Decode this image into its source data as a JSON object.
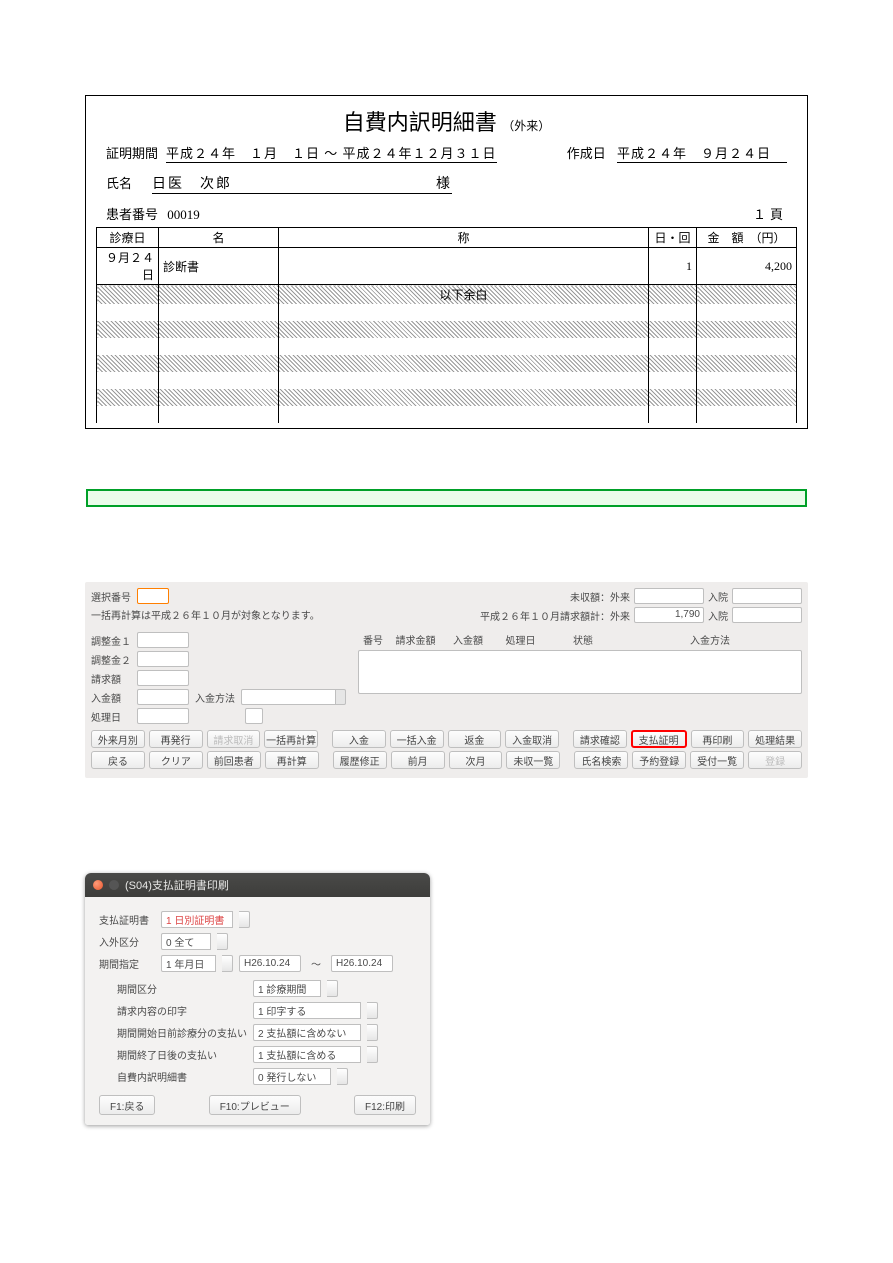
{
  "report": {
    "title_main": "自費内訳明細書",
    "title_sub": "（外来）",
    "period_label": "証明期間",
    "period_value": "平成２４年　１月　１日 ～ 平成２４年１２月３１日",
    "created_label": "作成日",
    "created_value": "平成２４年　９月２４日",
    "name_label": "氏名",
    "name_value": "日医　次郎",
    "name_suffix": "様",
    "patient_id_label": "患者番号",
    "patient_id_value": "00019",
    "page_label": "１頁",
    "columns": {
      "date": "診療日",
      "name": "名",
      "desc": "称",
      "count": "日・回",
      "amount": "金　額　（円）"
    },
    "rows": [
      {
        "date": "９月２４日",
        "name": "診断書",
        "desc": "",
        "count": "1",
        "amount": "4,200"
      }
    ],
    "blank_below": "以下余白"
  },
  "gray": {
    "select_no_label": "選択番号",
    "note": "一括再計算は平成２６年１０月が対象となります。",
    "top_right_1_label": "未収額：外来",
    "top_right_1_in_label": "入院",
    "top_right_2_label": "平成２６年１０月請求額計：外来",
    "top_right_2_value": "1,790",
    "top_right_2_in_label": "入院",
    "adj1_label": "調整金１",
    "adj2_label": "調整金２",
    "bill_label": "請求額",
    "deposit_label": "入金額",
    "method_label": "入金方法",
    "procdate_label": "処理日",
    "list_headers": {
      "no": "番号",
      "bill": "請求金額",
      "deposit": "入金額",
      "procdate": "処理日",
      "status": "状態",
      "method": "入金方法"
    },
    "buttons_row1": [
      "外来月別",
      "再発行",
      "請求取消",
      "一括再計算",
      "",
      "入金",
      "一括入金",
      "返金",
      "入金取消",
      "",
      "請求確認",
      "支払証明",
      "再印刷",
      "処理結果"
    ],
    "buttons_row2": [
      "戻る",
      "クリア",
      "前回患者",
      "再計算",
      "",
      "履歴修正",
      "前月",
      "次月",
      "未収一覧",
      "",
      "氏名検索",
      "予約登録",
      "受付一覧",
      "登録"
    ]
  },
  "dialog": {
    "title": "(S04)支払証明書印刷",
    "rows": {
      "cert_label": "支払証明書",
      "cert_value": "1 日別証明書",
      "io_label": "入外区分",
      "io_value": "0 全て",
      "period_label": "期間指定",
      "period_value": "1 年月日",
      "date_from": "H26.10.24",
      "date_to": "H26.10.24"
    },
    "sub": {
      "kikan_label": "期間区分",
      "kikan_value": "1 診療期間",
      "print_label": "請求内容の印字",
      "print_value": "1 印字する",
      "before_label": "期間開始日前診療分の支払い",
      "before_value": "2 支払額に含めない",
      "after_label": "期間終了日後の支払い",
      "after_value": "1 支払額に含める",
      "jihi_label": "自費内訳明細書",
      "jihi_value": "0 発行しない"
    },
    "btns": {
      "back": "F1:戻る",
      "preview": "F10:プレビュー",
      "print": "F12:印刷"
    }
  }
}
